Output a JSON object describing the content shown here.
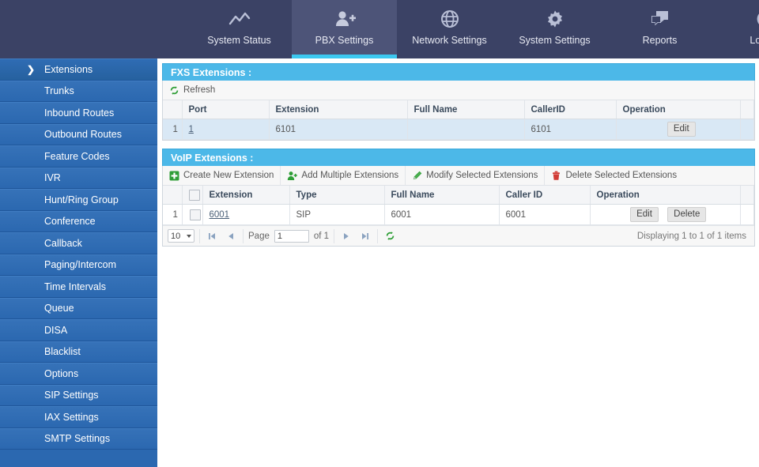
{
  "topnav": {
    "tabs": [
      {
        "label": "System Status",
        "icon": "chart-line-icon",
        "active": false
      },
      {
        "label": "PBX Settings",
        "icon": "user-add-icon",
        "active": true
      },
      {
        "label": "Network Settings",
        "icon": "globe-icon",
        "active": false
      },
      {
        "label": "System Settings",
        "icon": "gear-icon",
        "active": false
      },
      {
        "label": "Reports",
        "icon": "chat-bubbles-icon",
        "active": false
      },
      {
        "label": "Logout",
        "icon": "close-circle-icon",
        "active": false
      }
    ]
  },
  "sidebar": {
    "items": [
      {
        "label": "Extensions",
        "active": true
      },
      {
        "label": "Trunks",
        "active": false
      },
      {
        "label": "Inbound Routes",
        "active": false
      },
      {
        "label": "Outbound Routes",
        "active": false
      },
      {
        "label": "Feature Codes",
        "active": false
      },
      {
        "label": "IVR",
        "active": false
      },
      {
        "label": "Hunt/Ring Group",
        "active": false
      },
      {
        "label": "Conference",
        "active": false
      },
      {
        "label": "Callback",
        "active": false
      },
      {
        "label": "Paging/Intercom",
        "active": false
      },
      {
        "label": "Time Intervals",
        "active": false
      },
      {
        "label": "Queue",
        "active": false
      },
      {
        "label": "DISA",
        "active": false
      },
      {
        "label": "Blacklist",
        "active": false
      },
      {
        "label": "Options",
        "active": false
      },
      {
        "label": "SIP Settings",
        "active": false
      },
      {
        "label": "IAX Settings",
        "active": false
      },
      {
        "label": "SMTP Settings",
        "active": false
      }
    ]
  },
  "fxs_panel": {
    "title": "FXS Extensions :",
    "refresh_label": "Refresh",
    "columns": {
      "port": "Port",
      "extension": "Extension",
      "full_name": "Full Name",
      "callerid": "CallerID",
      "operation": "Operation"
    },
    "rows": [
      {
        "index": "1",
        "port": "1",
        "extension": "6101",
        "full_name": "",
        "callerid": "6101",
        "edit_label": "Edit"
      }
    ]
  },
  "voip_panel": {
    "title": "VoIP Extensions :",
    "toolbar": {
      "create": "Create New Extension",
      "add_multiple": "Add Multiple Extensions",
      "modify": "Modify Selected Extensions",
      "delete": "Delete Selected Extensions"
    },
    "columns": {
      "extension": "Extension",
      "type": "Type",
      "full_name": "Full Name",
      "caller_id": "Caller ID",
      "operation": "Operation"
    },
    "rows": [
      {
        "index": "1",
        "extension": "6001",
        "type": "SIP",
        "full_name": "6001",
        "caller_id": "6001",
        "edit_label": "Edit",
        "delete_label": "Delete"
      }
    ],
    "pager": {
      "page_size": "10",
      "page_label": "Page",
      "page_value": "1",
      "of_label": "of 1",
      "info": "Displaying 1 to 1 of 1 items"
    }
  },
  "colors": {
    "nav_bg": "#3b4265",
    "nav_active": "#4d5478",
    "accent_underline": "#3cc8f0",
    "sidebar_bg": "#2b68b0",
    "panel_header": "#4cb8e8",
    "row_highlight": "#d9e8f5",
    "icon_green": "#2e9e36",
    "icon_red": "#d13b35"
  }
}
